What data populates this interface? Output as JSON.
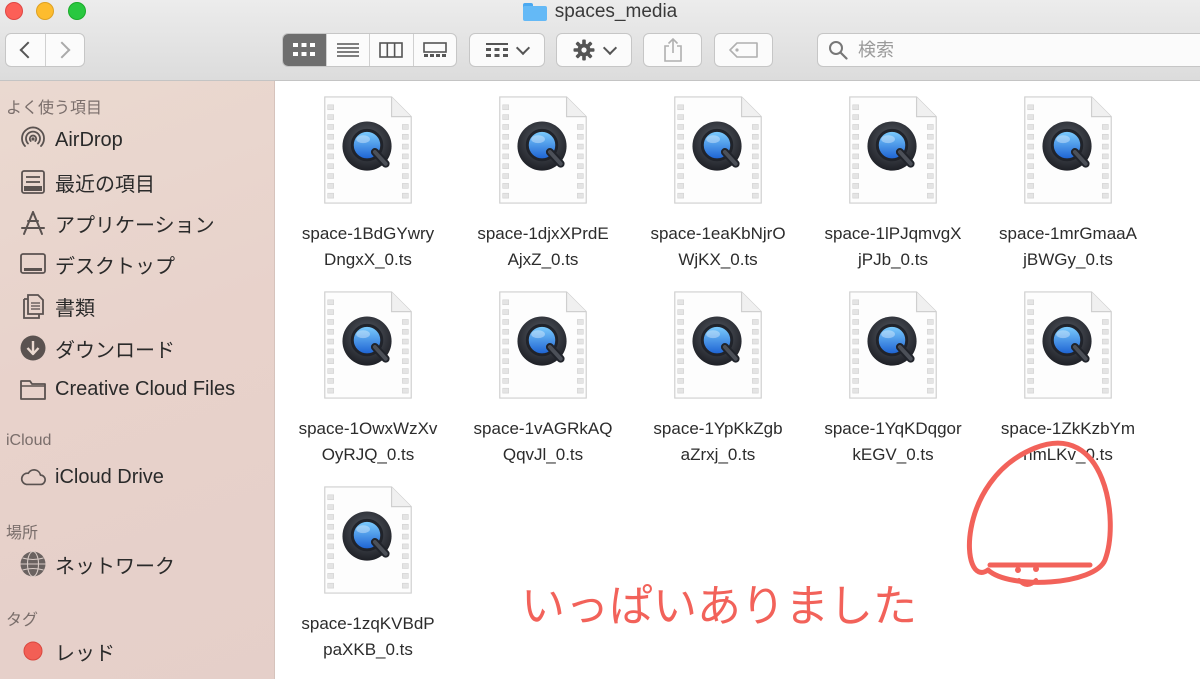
{
  "window": {
    "title": "spaces_media"
  },
  "toolbar": {
    "search_placeholder": "検索"
  },
  "sidebar": {
    "sections": [
      {
        "label": "よく使う項目",
        "items": [
          {
            "label": "AirDrop",
            "icon": "airdrop-icon"
          },
          {
            "label": "最近の項目",
            "icon": "recents-icon"
          },
          {
            "label": "アプリケーション",
            "icon": "applications-icon"
          },
          {
            "label": "デスクトップ",
            "icon": "desktop-icon"
          },
          {
            "label": "書類",
            "icon": "documents-icon"
          },
          {
            "label": "ダウンロード",
            "icon": "downloads-icon"
          },
          {
            "label": "Creative Cloud Files",
            "icon": "folder-icon"
          }
        ]
      },
      {
        "label": "iCloud",
        "items": [
          {
            "label": "iCloud Drive",
            "icon": "cloud-icon"
          }
        ]
      },
      {
        "label": "場所",
        "items": [
          {
            "label": "ネットワーク",
            "icon": "network-icon"
          }
        ]
      },
      {
        "label": "タグ",
        "items": [
          {
            "label": "レッド",
            "icon": "red-tag-icon",
            "color": "#f25f55"
          }
        ]
      }
    ]
  },
  "files": [
    {
      "line1": "space-1BdGYwry",
      "line2": "DngxX_0.ts"
    },
    {
      "line1": "space-1djxXPrdE",
      "line2": "AjxZ_0.ts"
    },
    {
      "line1": "space-1eaKbNjrO",
      "line2": "WjKX_0.ts"
    },
    {
      "line1": "space-1lPJqmvgX",
      "line2": "jPJb_0.ts"
    },
    {
      "line1": "space-1mrGmaaA",
      "line2": "jBWGy_0.ts"
    },
    {
      "line1": "space-1OwxWzXv",
      "line2": "OyRJQ_0.ts"
    },
    {
      "line1": "space-1vAGRkAQ",
      "line2": "QqvJl_0.ts"
    },
    {
      "line1": "space-1YpKkZgb",
      "line2": "aZrxj_0.ts"
    },
    {
      "line1": "space-1YqKDqgor",
      "line2": "kEGV_0.ts"
    },
    {
      "line1": "space-1ZkKzbYm",
      "line2": "nmLKv_0.ts"
    },
    {
      "line1": "space-1zqKVBdP",
      "line2": "paXKB_0.ts"
    }
  ],
  "annotation": {
    "text": "いっぱいありました",
    "color": "#f2625a"
  }
}
